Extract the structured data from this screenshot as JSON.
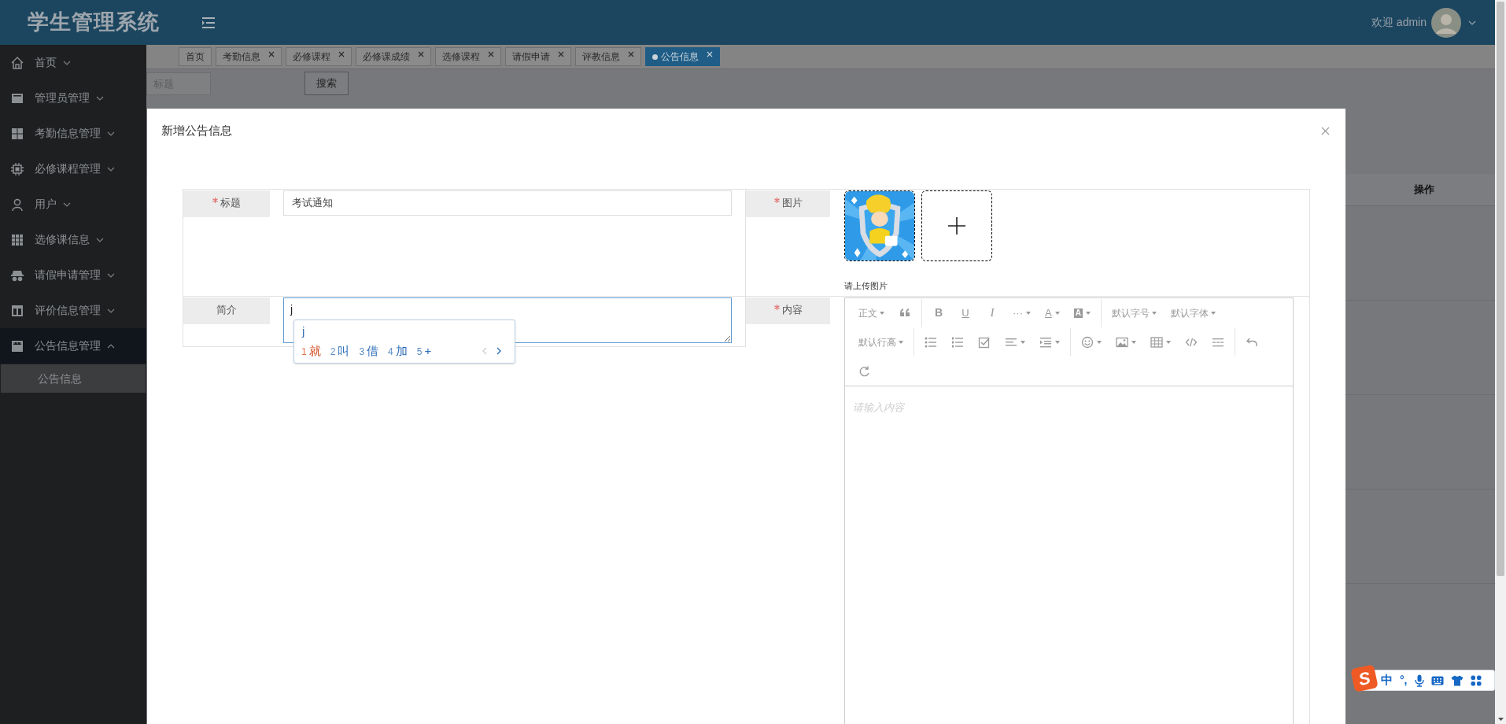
{
  "header": {
    "title": "学生管理系统",
    "greeting": "欢迎 admin"
  },
  "sidebar": {
    "items": [
      {
        "label": "首页",
        "expanded": false,
        "selected": false
      },
      {
        "label": "管理员管理",
        "expanded": false,
        "selected": false
      },
      {
        "label": "考勤信息管理",
        "expanded": false,
        "selected": false
      },
      {
        "label": "必修课程管理",
        "expanded": false,
        "selected": false
      },
      {
        "label": "用户",
        "expanded": false,
        "selected": false
      },
      {
        "label": "选修课信息",
        "expanded": false,
        "selected": false
      },
      {
        "label": "请假申请管理",
        "expanded": false,
        "selected": false
      },
      {
        "label": "评价信息管理",
        "expanded": false,
        "selected": false
      },
      {
        "label": "公告信息管理",
        "expanded": true,
        "selected": true,
        "children": [
          {
            "label": "公告信息",
            "selected": true
          }
        ]
      }
    ]
  },
  "tabs": [
    {
      "label": "首页",
      "closable": false,
      "selected": false
    },
    {
      "label": "考勤信息",
      "closable": true,
      "selected": false
    },
    {
      "label": "必修课程",
      "closable": true,
      "selected": false
    },
    {
      "label": "必修课成绩",
      "closable": true,
      "selected": false
    },
    {
      "label": "选修课程",
      "closable": true,
      "selected": false
    },
    {
      "label": "请假申请",
      "closable": true,
      "selected": false
    },
    {
      "label": "评教信息",
      "closable": true,
      "selected": false
    },
    {
      "label": "公告信息",
      "closable": true,
      "selected": true
    }
  ],
  "search": {
    "placeholder": "标题",
    "button": "搜索"
  },
  "table": {
    "columns": [
      "操作"
    ]
  },
  "modal": {
    "title": "新增公告信息",
    "left": [
      {
        "kind": "input",
        "label": "标题",
        "required": true,
        "value": "考试通知"
      },
      {
        "kind": "textarea",
        "label": "简介",
        "required": false,
        "value": "j",
        "focused": true
      }
    ],
    "right": [
      {
        "kind": "upload",
        "label": "图片",
        "required": true,
        "hint": "请上传图片"
      },
      {
        "kind": "editor",
        "label": "内容",
        "required": true,
        "placeholder": "请输入内容",
        "toolbar": [
          [
            {
              "kind": "dropdown",
              "label": "正文"
            },
            {
              "kind": "icon"
            },
            {
              "kind": "separator"
            },
            {
              "kind": "glyph",
              "label": "B"
            },
            {
              "kind": "glyph",
              "label": "U"
            },
            {
              "kind": "glyph",
              "label": "I"
            },
            {
              "kind": "glyph",
              "label": "···",
              "caret": true
            },
            {
              "kind": "glyph",
              "label": "A",
              "caret": true
            },
            {
              "kind": "glyph",
              "label": "A",
              "caret": true
            },
            {
              "kind": "separator"
            },
            {
              "kind": "dropdown",
              "label": "默认字号"
            },
            {
              "kind": "dropdown",
              "label": "默认字体"
            }
          ],
          [
            {
              "kind": "dropdown",
              "label": "默认行高"
            },
            {
              "kind": "separator"
            },
            {
              "kind": "icon"
            },
            {
              "kind": "icon"
            },
            {
              "kind": "icon"
            },
            {
              "kind": "icon",
              "caret": true
            },
            {
              "kind": "icon",
              "caret": true
            },
            {
              "kind": "separator"
            },
            {
              "kind": "icon",
              "caret": true
            },
            {
              "kind": "icon",
              "caret": true
            },
            {
              "kind": "icon",
              "caret": true
            },
            {
              "kind": "icon"
            },
            {
              "kind": "icon"
            },
            {
              "kind": "separator"
            },
            {
              "kind": "icon"
            }
          ],
          [
            {
              "kind": "icon"
            }
          ]
        ]
      }
    ]
  },
  "ime": {
    "composition": "j",
    "candidates": [
      {
        "number": "1",
        "text": "就",
        "selected": true
      },
      {
        "number": "2",
        "text": "叫",
        "selected": false
      },
      {
        "number": "3",
        "text": "借",
        "selected": false
      },
      {
        "number": "4",
        "text": "加",
        "selected": false
      },
      {
        "number": "5",
        "text": "+",
        "selected": false
      }
    ]
  },
  "ime_bar": {
    "logo": "S",
    "mode": "中",
    "punctuation": "°,"
  }
}
